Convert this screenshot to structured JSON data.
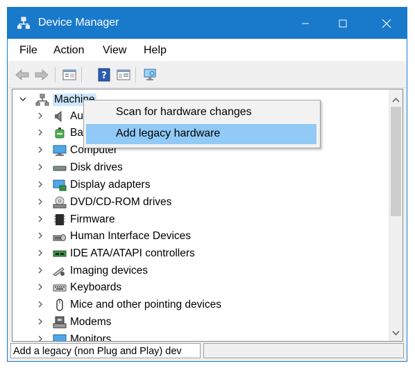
{
  "window": {
    "title": "Device Manager",
    "accent_color": "#1979ca",
    "controls": {
      "minimize": "minimize-icon",
      "maximize": "maximize-icon",
      "close": "close-icon"
    }
  },
  "menubar": {
    "items": [
      {
        "label": "File"
      },
      {
        "label": "Action"
      },
      {
        "label": "View"
      },
      {
        "label": "Help"
      }
    ]
  },
  "toolbar": {
    "icons": [
      "back-arrow-icon",
      "forward-arrow-icon",
      "properties-icon",
      "help-icon",
      "show-hide-console-tree-icon",
      "scan-hardware-icon"
    ]
  },
  "tree": {
    "root": {
      "label": "Machine",
      "expanded": true,
      "selected_color": "#cce8ff"
    },
    "items": [
      {
        "label": "Au",
        "icon": "speaker-icon"
      },
      {
        "label": "Ba",
        "icon": "battery-icon"
      },
      {
        "label": "Computer",
        "icon": "computer-monitor-icon"
      },
      {
        "label": "Disk drives",
        "icon": "disk-drive-icon"
      },
      {
        "label": "Display adapters",
        "icon": "display-adapter-icon"
      },
      {
        "label": "DVD/CD-ROM drives",
        "icon": "dvd-drive-icon"
      },
      {
        "label": "Firmware",
        "icon": "firmware-chip-icon"
      },
      {
        "label": "Human Interface Devices",
        "icon": "hid-icon"
      },
      {
        "label": "IDE ATA/ATAPI controllers",
        "icon": "ide-controller-icon"
      },
      {
        "label": "Imaging devices",
        "icon": "camera-icon"
      },
      {
        "label": "Keyboards",
        "icon": "keyboard-icon"
      },
      {
        "label": "Mice and other pointing devices",
        "icon": "mouse-icon"
      },
      {
        "label": "Modems",
        "icon": "modem-icon"
      },
      {
        "label": "Monitors",
        "icon": "monitor-icon"
      }
    ]
  },
  "context_menu": {
    "items": [
      {
        "label": "Scan for hardware changes",
        "highlighted": false
      },
      {
        "label": "Add legacy hardware",
        "highlighted": true
      }
    ],
    "highlight_color": "#91c9f7"
  },
  "statusbar": {
    "text": "Add a legacy (non Plug and Play) dev"
  }
}
